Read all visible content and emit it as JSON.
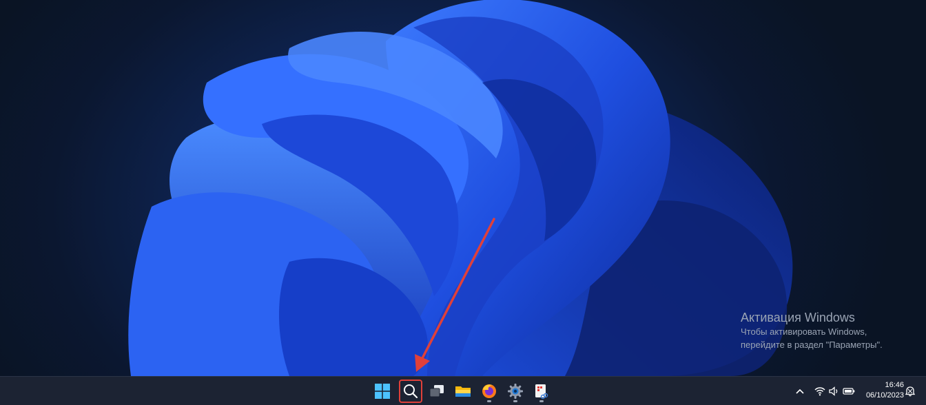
{
  "watermark": {
    "title": "Активация Windows",
    "line1": "Чтобы активировать Windows,",
    "line2": "перейдите в раздел \"Параметры\"."
  },
  "taskbar": {
    "apps": [
      {
        "name": "start",
        "icon": "windows-logo-icon"
      },
      {
        "name": "search",
        "icon": "search-icon",
        "highlighted": true
      },
      {
        "name": "task-view",
        "icon": "task-view-icon"
      },
      {
        "name": "file-explorer",
        "icon": "folder-icon"
      },
      {
        "name": "firefox",
        "icon": "firefox-icon",
        "running": true
      },
      {
        "name": "settings",
        "icon": "gear-icon",
        "running": true
      },
      {
        "name": "snipping-tool",
        "icon": "snipping-tool-icon",
        "running": true
      }
    ],
    "tray": {
      "icons": [
        "chevron-up-icon",
        "wifi-icon",
        "volume-icon",
        "battery-icon",
        "notification-icon"
      ]
    },
    "clock": {
      "time": "16:46",
      "date": "06/10/2023"
    }
  },
  "annotation": {
    "color": "#e0403a",
    "target": "search-button"
  }
}
